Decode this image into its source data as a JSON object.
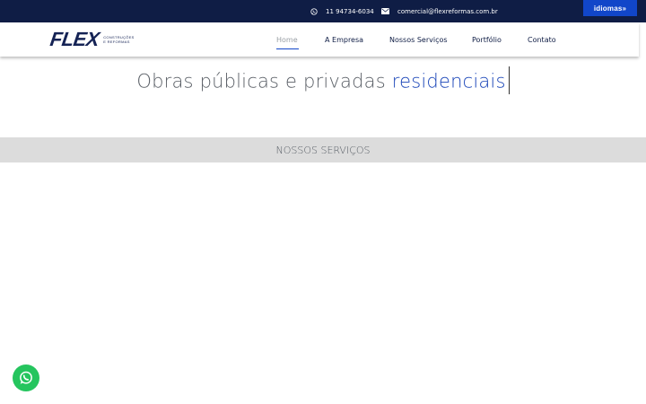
{
  "topbar": {
    "phone": "11 94734-6034",
    "email": "comercial@flexreformas.com.br",
    "language_button": "idiomas»",
    "icons": {
      "phone": "whatsapp-icon",
      "email": "envelope-icon"
    },
    "colors": {
      "background": "#0f1d45",
      "language_button": "#1146c9"
    }
  },
  "header": {
    "logo": {
      "word": "FLEX",
      "tagline_line1": "CONSTRUÇÕES",
      "tagline_line2": "E REFORMAS"
    },
    "nav": [
      {
        "label": "Home",
        "active": true
      },
      {
        "label": "A Empresa"
      },
      {
        "label": "Nossos Serviços"
      },
      {
        "label": "Portfólio"
      },
      {
        "label": "Contato"
      }
    ]
  },
  "hero": {
    "text": "Obras públicas e privadas ",
    "accent_text": "residenciais",
    "accent_color": "#1a45b8"
  },
  "section": {
    "title": "NOSSOS SERVIÇOS",
    "background": "#dcdcdc"
  },
  "floating": {
    "whatsapp_icon": "whatsapp-icon",
    "color": "#25c55e"
  }
}
